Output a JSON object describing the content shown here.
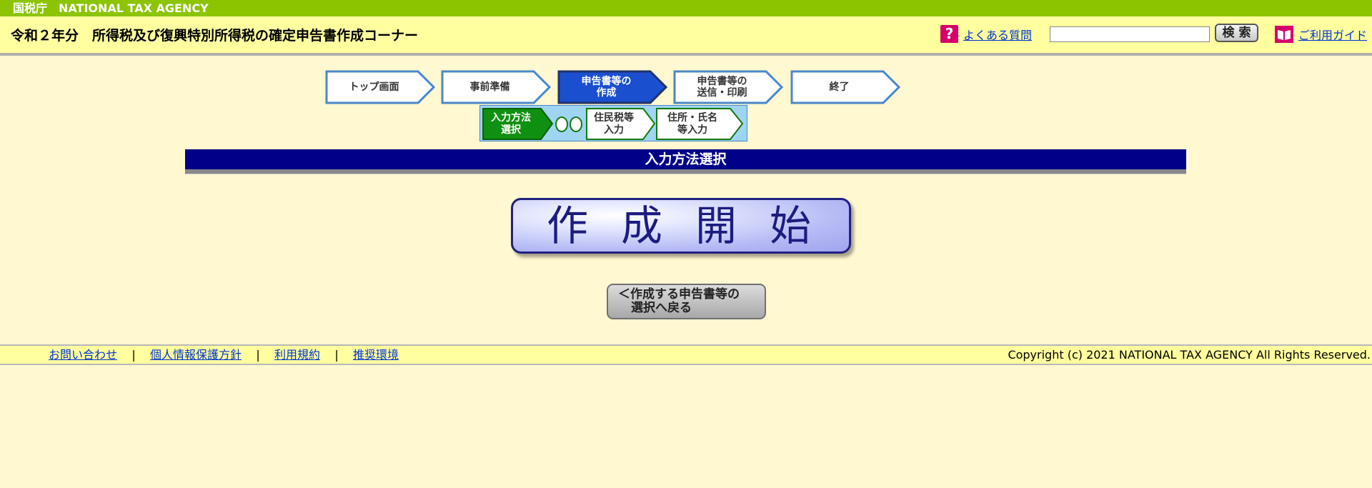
{
  "agency": {
    "name": "国税庁　NATIONAL TAX AGENCY"
  },
  "header": {
    "title": "令和２年分　所得税及び復興特別所得税の確定申告書作成コーナー",
    "faq_label": "よくある質問",
    "search_value": "",
    "search_button": "検 索",
    "guide_label": "ご利用ガイド"
  },
  "steps": [
    {
      "label": "トップ画面",
      "state": "done"
    },
    {
      "label": "事前準備",
      "state": "done"
    },
    {
      "label": "申告書等の 作成",
      "state": "active"
    },
    {
      "label": "申告書等の 送信・印刷",
      "state": "pending"
    },
    {
      "label": "終了",
      "state": "pending"
    }
  ],
  "substeps": [
    {
      "label": "入力方法 選択",
      "state": "active"
    },
    {
      "label": "住民税等 入力",
      "state": "pending"
    },
    {
      "label": "住所・氏名 等入力",
      "state": "pending"
    }
  ],
  "section": {
    "title": "入力方法選択"
  },
  "start_button": "作成開始",
  "back_button": {
    "line1": "＜作成する申告書等の",
    "line2": "選択へ戻る"
  },
  "footer": {
    "links": [
      "お問い合わせ",
      "個人情報保護方針",
      "利用規約",
      "推奨環境"
    ],
    "separator": "|",
    "copyright": "Copyright (c) 2021 NATIONAL TAX AGENCY All Rights Reserved."
  },
  "colors": {
    "background": "#fff8d0",
    "agency_bar": "#8cc400",
    "header": "#ffffa0",
    "active_step": "#1a4fd0",
    "section_title": "#000088",
    "active_substep": "#109010",
    "link": "#0033cc"
  },
  "icons": {
    "faq": "question-icon",
    "guide": "book-icon"
  }
}
